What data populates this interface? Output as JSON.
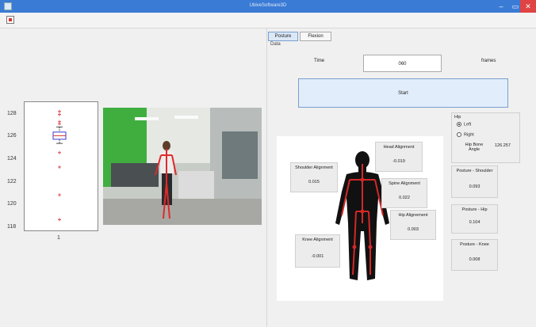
{
  "window": {
    "title": "UbiveSoftware3D",
    "minimize_glyph": "–",
    "maximize_glyph": "▭",
    "close_glyph": "✕"
  },
  "boxplot": {
    "y_ticks": [
      "128",
      "126",
      "124",
      "122",
      "120",
      "118"
    ],
    "x_tick": "1",
    "y_range": [
      117.5,
      129.5
    ],
    "quartiles": {
      "q1": 126.2,
      "median": 126.55,
      "q3": 126.9
    },
    "whiskers": [
      125.8,
      127.4
    ],
    "outliers": [
      128.9,
      128.6,
      127.9,
      127.7,
      124.9,
      123.5,
      120.8,
      118.4
    ],
    "colors": {
      "box": "#3b3bd6",
      "median": "#d62f2f",
      "outlier": "#d62f2f"
    }
  },
  "tabs": [
    {
      "label": "Posture",
      "active": true
    },
    {
      "label": "Flexion",
      "active": false
    }
  ],
  "data_group_label": "Data",
  "time": {
    "label": "Time",
    "value": "060",
    "unit": "frames"
  },
  "start_button": "Start",
  "alignments": {
    "head": {
      "label": "Head Alignment",
      "value": "-0.019"
    },
    "shoulder": {
      "label": "Shoulder Alignment",
      "value": "0.015"
    },
    "spine": {
      "label": "Spine Alignment",
      "value": "0.022"
    },
    "hip": {
      "label": "Hip Alignement",
      "value": "0.003"
    },
    "knee": {
      "label": "Knee Alignment",
      "value": "-0.001"
    }
  },
  "hip_panel": {
    "title": "Hip",
    "options": [
      "Left",
      "Right"
    ],
    "selected": "Left",
    "bone_angle_label_1": "Hip Bone",
    "bone_angle_label_2": "Angle",
    "bone_angle_value": "126.257"
  },
  "posture": {
    "shoulder": {
      "label": "Posture - Shoulder",
      "value": "0.093"
    },
    "hip": {
      "label": "Posture - Hip",
      "value": "0.104"
    },
    "knee": {
      "label": "Posture - Knee",
      "value": "0.008"
    }
  }
}
